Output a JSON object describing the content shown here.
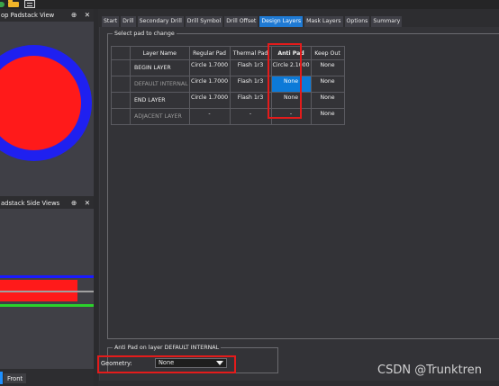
{
  "toolbar": {
    "icons": [
      "add-icon",
      "folder-icon",
      "document-icon"
    ]
  },
  "top_panel": {
    "title": "op Padstack View",
    "pin_glyph": "⊕",
    "close_glyph": "✕",
    "colors": {
      "outer_ring": "#1f20f0",
      "inner_pad": "#ff1a1a"
    }
  },
  "side_panel": {
    "title": "adstack Side Views",
    "pin_glyph": "⊕",
    "close_glyph": "✕",
    "colors": {
      "blue_line": "#1a1aff",
      "red_pad": "#ff1a1a",
      "gray_line": "#a0a0a0",
      "green_line": "#2bd12b"
    }
  },
  "bottom_tabs": {
    "front_label": "Front"
  },
  "tabs": [
    {
      "label": "Start",
      "active": false
    },
    {
      "label": "Drill",
      "active": false
    },
    {
      "label": "Secondary Drill",
      "active": false
    },
    {
      "label": "Drill Symbol",
      "active": false
    },
    {
      "label": "Drill Offset",
      "active": false
    },
    {
      "label": "Design Layers",
      "active": true
    },
    {
      "label": "Mask Layers",
      "active": false
    },
    {
      "label": "Options",
      "active": false
    },
    {
      "label": "Summary",
      "active": false
    }
  ],
  "pad_group": {
    "title": "Select pad to change",
    "columns": [
      "Layer Name",
      "Regular Pad",
      "Thermal Pad",
      "Anti Pad",
      "Keep Out"
    ],
    "rows": [
      {
        "layer": "BEGIN LAYER",
        "regular": "Circle 1.7000",
        "thermal": "Flash 1r3",
        "anti": "Circle 2.1000",
        "keepout": "None"
      },
      {
        "layer": "DEFAULT INTERNAL",
        "regular": "Circle 1.7000",
        "thermal": "Flash 1r3",
        "anti": "None",
        "keepout": "None"
      },
      {
        "layer": "END LAYER",
        "regular": "Circle 1.7000",
        "thermal": "Flash 1r3",
        "anti": "None",
        "keepout": "None"
      },
      {
        "layer": "ADJACENT LAYER",
        "regular": "-",
        "thermal": "-",
        "anti": "-",
        "keepout": "None"
      }
    ]
  },
  "anti_group": {
    "title": "Anti Pad on layer DEFAULT INTERNAL",
    "geometry_label": "Geometry:",
    "geometry_value": "None"
  },
  "colors": {
    "accent": "#1f7ad4",
    "highlight_box": "#e41b1b",
    "selected_cell": "#0c7ad8"
  },
  "watermark": "CSDN @Trunktren"
}
